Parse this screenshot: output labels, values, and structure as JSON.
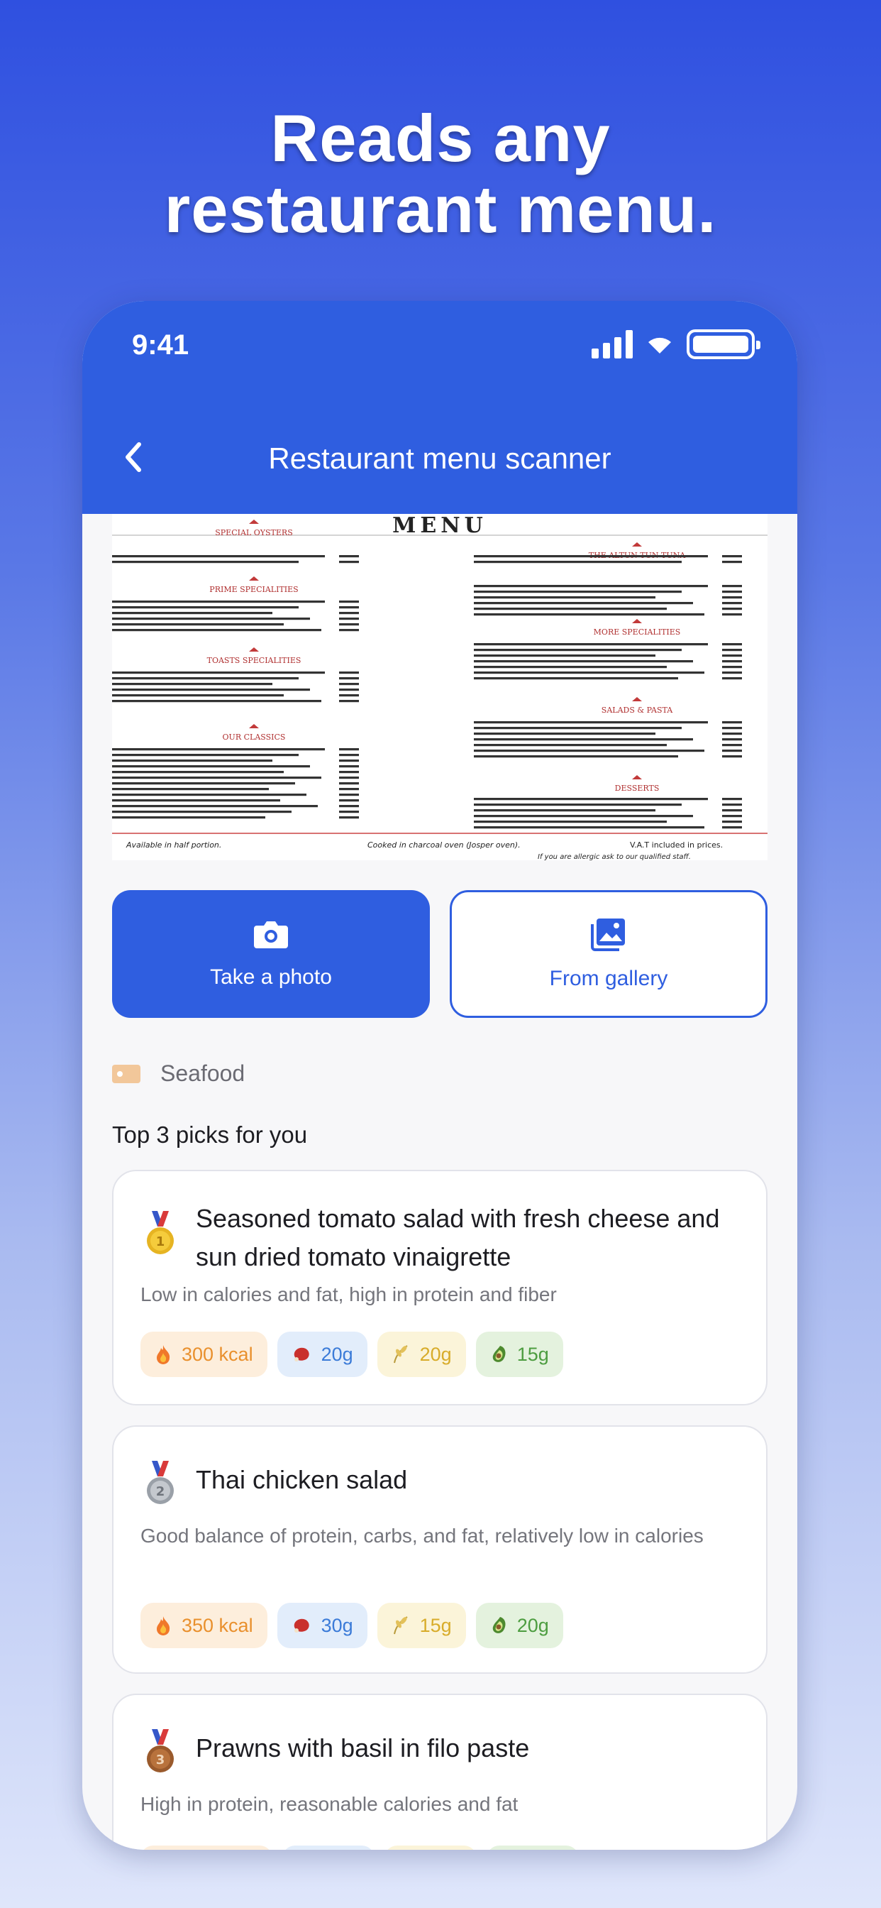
{
  "headline": {
    "line1": "Reads any",
    "line2": "restaurant menu."
  },
  "status_bar": {
    "time": "9:41"
  },
  "nav": {
    "title": "Restaurant menu scanner"
  },
  "actions": {
    "take_photo": "Take a photo",
    "from_gallery": "From gallery"
  },
  "category": {
    "label": "Seafood"
  },
  "section": {
    "title": "Top 3 picks for you"
  },
  "picks": [
    {
      "rank": "1",
      "title": "Seasoned tomato salad with fresh cheese and sun dried tomato vinaigrette",
      "description": "Low in calories and fat, high in protein and fiber",
      "kcal": "300 kcal",
      "protein": "20g",
      "carbs": "20g",
      "fat": "15g"
    },
    {
      "rank": "2",
      "title": "Thai chicken salad",
      "description": "Good balance of protein, carbs, and fat, relatively low in calories",
      "kcal": "350 kcal",
      "protein": "30g",
      "carbs": "15g",
      "fat": "20g"
    },
    {
      "rank": "3",
      "title": "Prawns with basil in filo paste",
      "description": "High in protein, reasonable calories and fat",
      "kcal": "",
      "protein": "",
      "carbs": "",
      "fat": ""
    }
  ],
  "menu_image": {
    "title": "MENU",
    "sections": [
      "SPECIAL OYSTERS",
      "PRIME SPECIALITIES",
      "THE ALTUN TUN TUNA",
      "TOASTS SPECIALITIES",
      "MORE SPECIALITIES",
      "OUR CLASSICS",
      "SALADS & PASTA",
      "DESSERTS"
    ],
    "footer": [
      "Available in half portion.",
      "Cooked in charcoal oven (Josper oven).",
      "V.A.T included in prices.",
      "If you are allergic ask to our qualified staff."
    ]
  },
  "colors": {
    "brand": "#2f5ee0",
    "kcal": "#e9902d",
    "protein": "#3b7bd8",
    "carbs": "#d8ac2a",
    "fat": "#4d9d40"
  },
  "icons": [
    "back-chevron-icon",
    "camera-icon",
    "gallery-icon",
    "tag-icon",
    "medal-icon",
    "fire-icon",
    "meat-icon",
    "grain-icon",
    "avocado-icon"
  ]
}
